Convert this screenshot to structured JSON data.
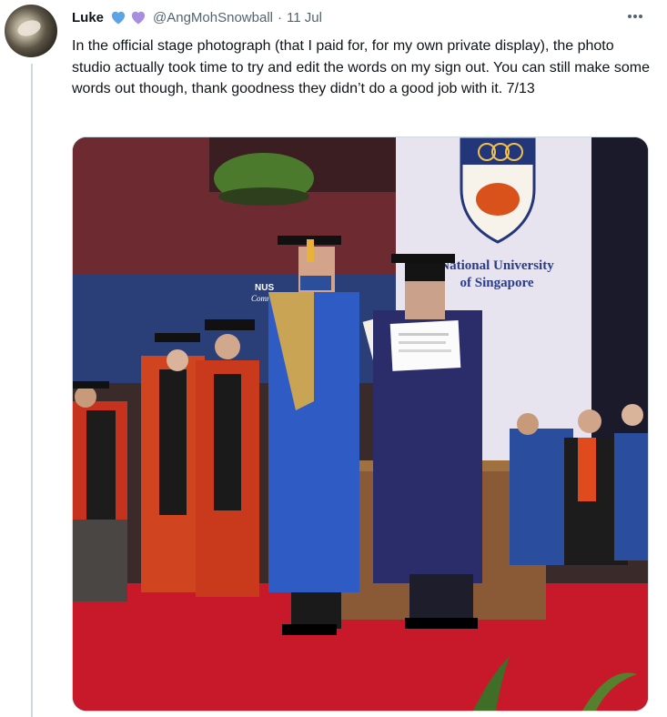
{
  "tweet": {
    "author_name": "Luke",
    "author_handle": "@AngMohSnowball",
    "separator": "·",
    "date": "11 Jul",
    "name_emoji_icons": [
      "blue-heart-icon",
      "purple-heart-icon"
    ],
    "text": "In the official stage photograph (that I paid for, for my own private display), the photo studio actually took time to try and edit the words on my sign out. You can still make some words out though, thank goodness they didn’t do a good job with it. 7/13"
  },
  "media": {
    "banner_line1": "National University",
    "banner_line2": "of Singapore",
    "screen_logo_text": "NUS",
    "screen_logo_sub": "Comme"
  },
  "colors": {
    "text_primary": "#0f1419",
    "text_secondary": "#536471",
    "border": "#cfd9de",
    "blue_heart": "#5ba5e6",
    "purple_heart": "#a98ee0"
  }
}
